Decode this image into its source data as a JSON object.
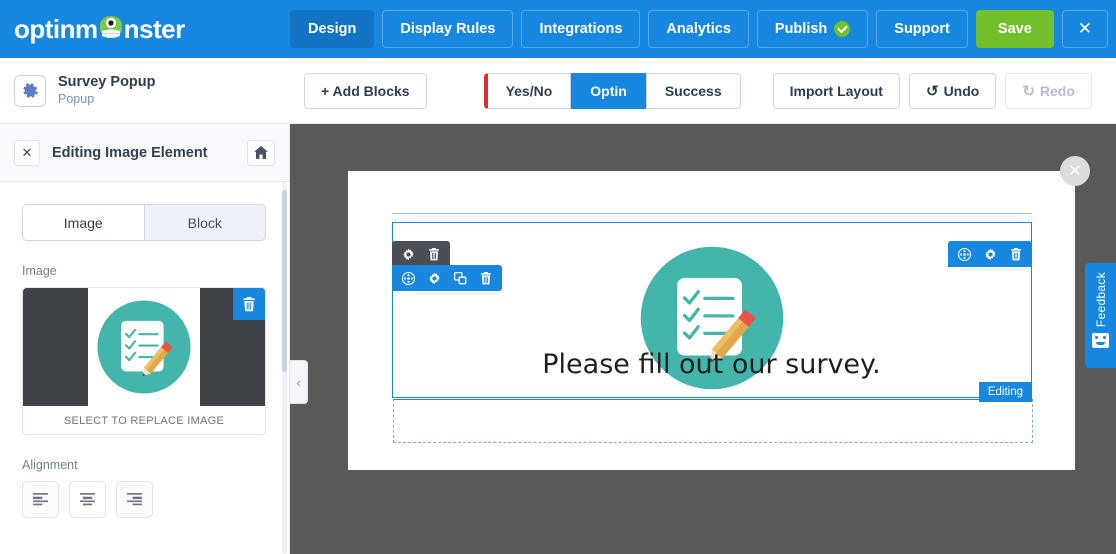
{
  "brand": {
    "name": "optinmonster",
    "accent_blue": "#1787e0",
    "accent_green": "#72c02c",
    "accent_teal": "#43b5ab",
    "accent_red": "#e02b35"
  },
  "topnav": {
    "items": [
      {
        "label": "Design",
        "active": true
      },
      {
        "label": "Display Rules",
        "active": false
      },
      {
        "label": "Integrations",
        "active": false
      },
      {
        "label": "Analytics",
        "active": false
      },
      {
        "label": "Publish",
        "active": false,
        "badge": "published-check"
      },
      {
        "label": "Support",
        "active": false
      }
    ],
    "save_label": "Save",
    "close_label": "✕"
  },
  "toolbar": {
    "project_title": "Survey Popup",
    "project_type": "Popup",
    "add_blocks_label": "+ Add Blocks",
    "views": [
      {
        "label": "Yes/No",
        "active": false
      },
      {
        "label": "Optin",
        "active": true
      },
      {
        "label": "Success",
        "active": false
      }
    ],
    "import_layout_label": "Import Layout",
    "undo_label": "Undo",
    "undo_icon": "↺",
    "redo_label": "Redo",
    "redo_icon": "↻",
    "redo_disabled": true
  },
  "sidebar": {
    "close_label": "✕",
    "title": "Editing Image Element",
    "home_icon": "home-icon",
    "tabs": [
      {
        "label": "Image",
        "active": true
      },
      {
        "label": "Block",
        "active": false
      }
    ],
    "image_field_label": "Image",
    "replace_hint": "SELECT TO REPLACE IMAGE",
    "delete_icon": "trash-icon",
    "alignment_label": "Alignment",
    "alignment_options": [
      {
        "name": "align-left",
        "selected": false
      },
      {
        "name": "align-center",
        "selected": true
      },
      {
        "name": "align-right",
        "selected": false
      }
    ]
  },
  "canvas": {
    "collapse_icon": "‹",
    "popup_close_label": "✕",
    "survey_text": "Please fill out our survey.",
    "editing_badge": "Editing",
    "row_toolbar_icons": [
      "gear-icon",
      "trash-icon"
    ],
    "block_toolbar_icons": [
      "move-icon",
      "gear-icon",
      "duplicate-icon",
      "trash-icon"
    ],
    "column_toolbar_icons": [
      "move-icon",
      "gear-icon",
      "trash-icon"
    ]
  },
  "feedback": {
    "label": "Feedback",
    "icon": "smiley-face-icon"
  }
}
